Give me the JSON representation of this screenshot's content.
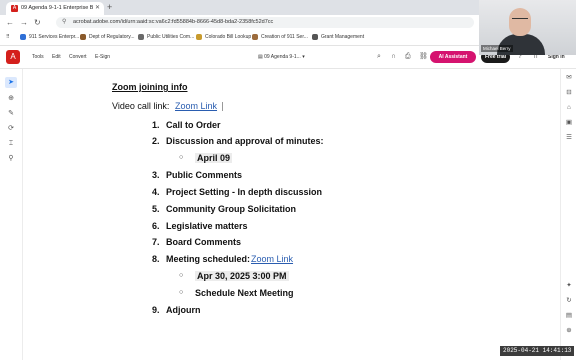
{
  "browser": {
    "tab_title": "09 Agenda 9-1-1 Enterprise B...",
    "url": "acrobat.adobe.com/id/urn:aaid:sc:va6c2:fd55884b-8666-45d8-bda2-2358fc52d7cc",
    "bookmarks": [
      {
        "label": "911 Services Enterpr...",
        "color": "#2f6fd6"
      },
      {
        "label": "Dept of Regulatory...",
        "color": "#8a5a2b"
      },
      {
        "label": "Public Utilities Com...",
        "color": "#6a6a6a"
      },
      {
        "label": "Colorado Bill Lookup",
        "color": "#c89b2e"
      },
      {
        "label": "Creation of 911 Ser...",
        "color": "#9c6b3c"
      },
      {
        "label": "Grant Management",
        "color": "#555555"
      }
    ]
  },
  "webcam": {
    "name": "Michael Berry"
  },
  "acrobat": {
    "menu": [
      "Tools",
      "Edit",
      "Convert",
      "E-Sign"
    ],
    "doc_title": "09 Agenda 9-1...",
    "ai_label": "AI Assistant",
    "free_trial": "Free trial",
    "sign_in": "Sign in",
    "accent": "#d5136f"
  },
  "doc": {
    "heading": "Zoom joining info",
    "video_prefix": "Video call link:",
    "video_link": "Zoom Link",
    "items": [
      {
        "num": "1.",
        "text": "Call to Order"
      },
      {
        "num": "2.",
        "text": "Discussion and approval of minutes:"
      },
      {
        "num": "3.",
        "text": "Public Comments"
      },
      {
        "num": "4.",
        "text": "Project Setting - In depth discussion"
      },
      {
        "num": "5.",
        "text": "Community Group Solicitation"
      },
      {
        "num": "6.",
        "text": "Legislative matters"
      },
      {
        "num": "7.",
        "text": "Board Comments"
      },
      {
        "num": "8.",
        "text": "Meeting scheduled:"
      },
      {
        "num": "9.",
        "text": "Adjourn"
      }
    ],
    "sub_minutes": "April 09",
    "meeting_link": "Zoom Link",
    "sub_date": "Apr 30, 2025 3:00 PM",
    "sub_schedule": "Schedule Next Meeting"
  },
  "timestamp": "2025-04-21  14:41:13"
}
